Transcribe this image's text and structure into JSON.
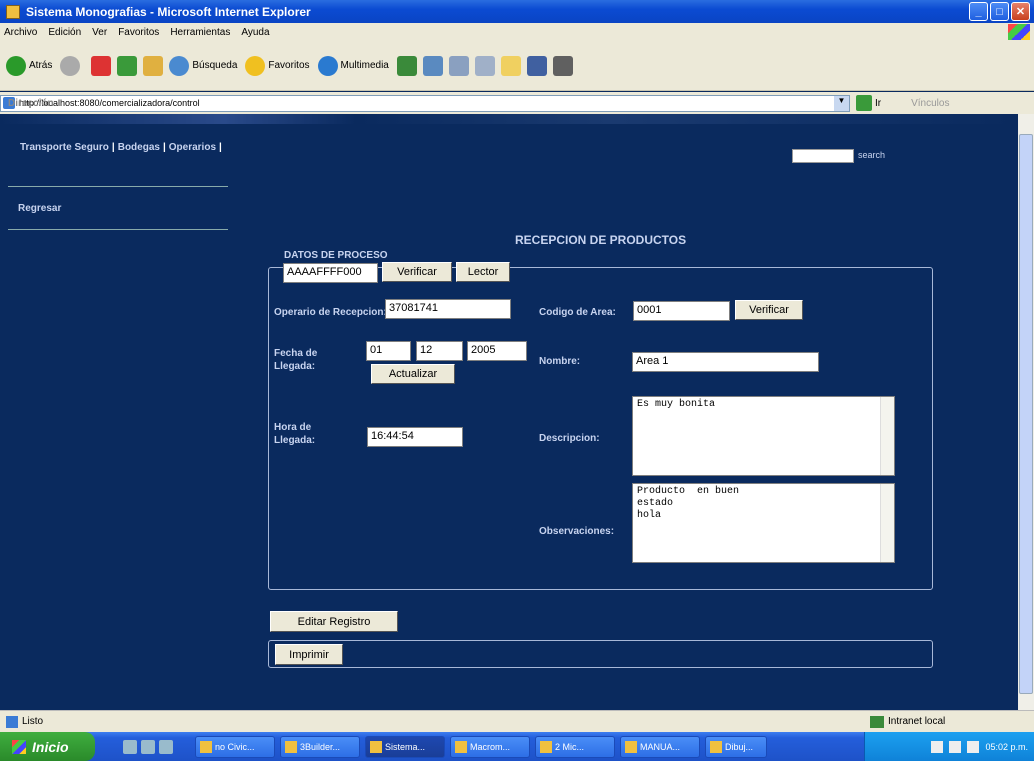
{
  "window": {
    "title": "Sistema Monografias - Microsoft Internet Explorer"
  },
  "menu": [
    "Archivo",
    "Edición",
    "Ver",
    "Favoritos",
    "Herramientas",
    "Ayuda"
  ],
  "toolbar": {
    "back": "Atrás",
    "search": "Búsqueda",
    "favorites": "Favoritos",
    "multimedia": "Multimedia"
  },
  "address": {
    "label": "Dirección",
    "url": "http://localhost:8080/comercializadora/control",
    "go": "Ir",
    "links": "Vínculos"
  },
  "nav": {
    "links": [
      "Transporte Seguro",
      "Bodegas",
      "Operarios"
    ],
    "search_link": "search",
    "regresar": "Regresar"
  },
  "form": {
    "title": "RECEPCION DE PRODUCTOS",
    "legend": "DATOS DE PROCESO",
    "code_value": "AAAAFFFF000",
    "verificar_label": "Verificar",
    "lector_label": "Lector",
    "operario_label": "Operario de Recepcion:",
    "operario_value": "37081741",
    "codigo_area_label": "Codigo de Area:",
    "codigo_area_value": "0001",
    "verificar2_label": "Verificar",
    "fecha_label_1": "Fecha de",
    "fecha_label_2": "Llegada:",
    "day": "01",
    "month": "12",
    "year": "2005",
    "actualizar_label": "Actualizar",
    "nombre_label": "Nombre:",
    "nombre_value": "Area 1",
    "hora_label_1": "Hora de",
    "hora_label_2": "Llegada:",
    "hora_value": "16:44:54",
    "descripcion_label": "Descripcion:",
    "descripcion_value": "Es muy bonita",
    "observaciones_label": "Observaciones:",
    "observaciones_value": "Producto  en buen\nestado\nhola",
    "editar_label": "Editar Registro",
    "imprimir_label": "Imprimir"
  },
  "status": {
    "text": "Listo",
    "zone": "Intranet local"
  },
  "taskbar": {
    "start": "Inicio",
    "tasks": [
      "no Civic...",
      "3Builder...",
      "Sistema...",
      "Macrom...",
      "2 Mic...",
      "MANUA...",
      "Dibuj..."
    ],
    "clock": "05:02 p.m."
  }
}
